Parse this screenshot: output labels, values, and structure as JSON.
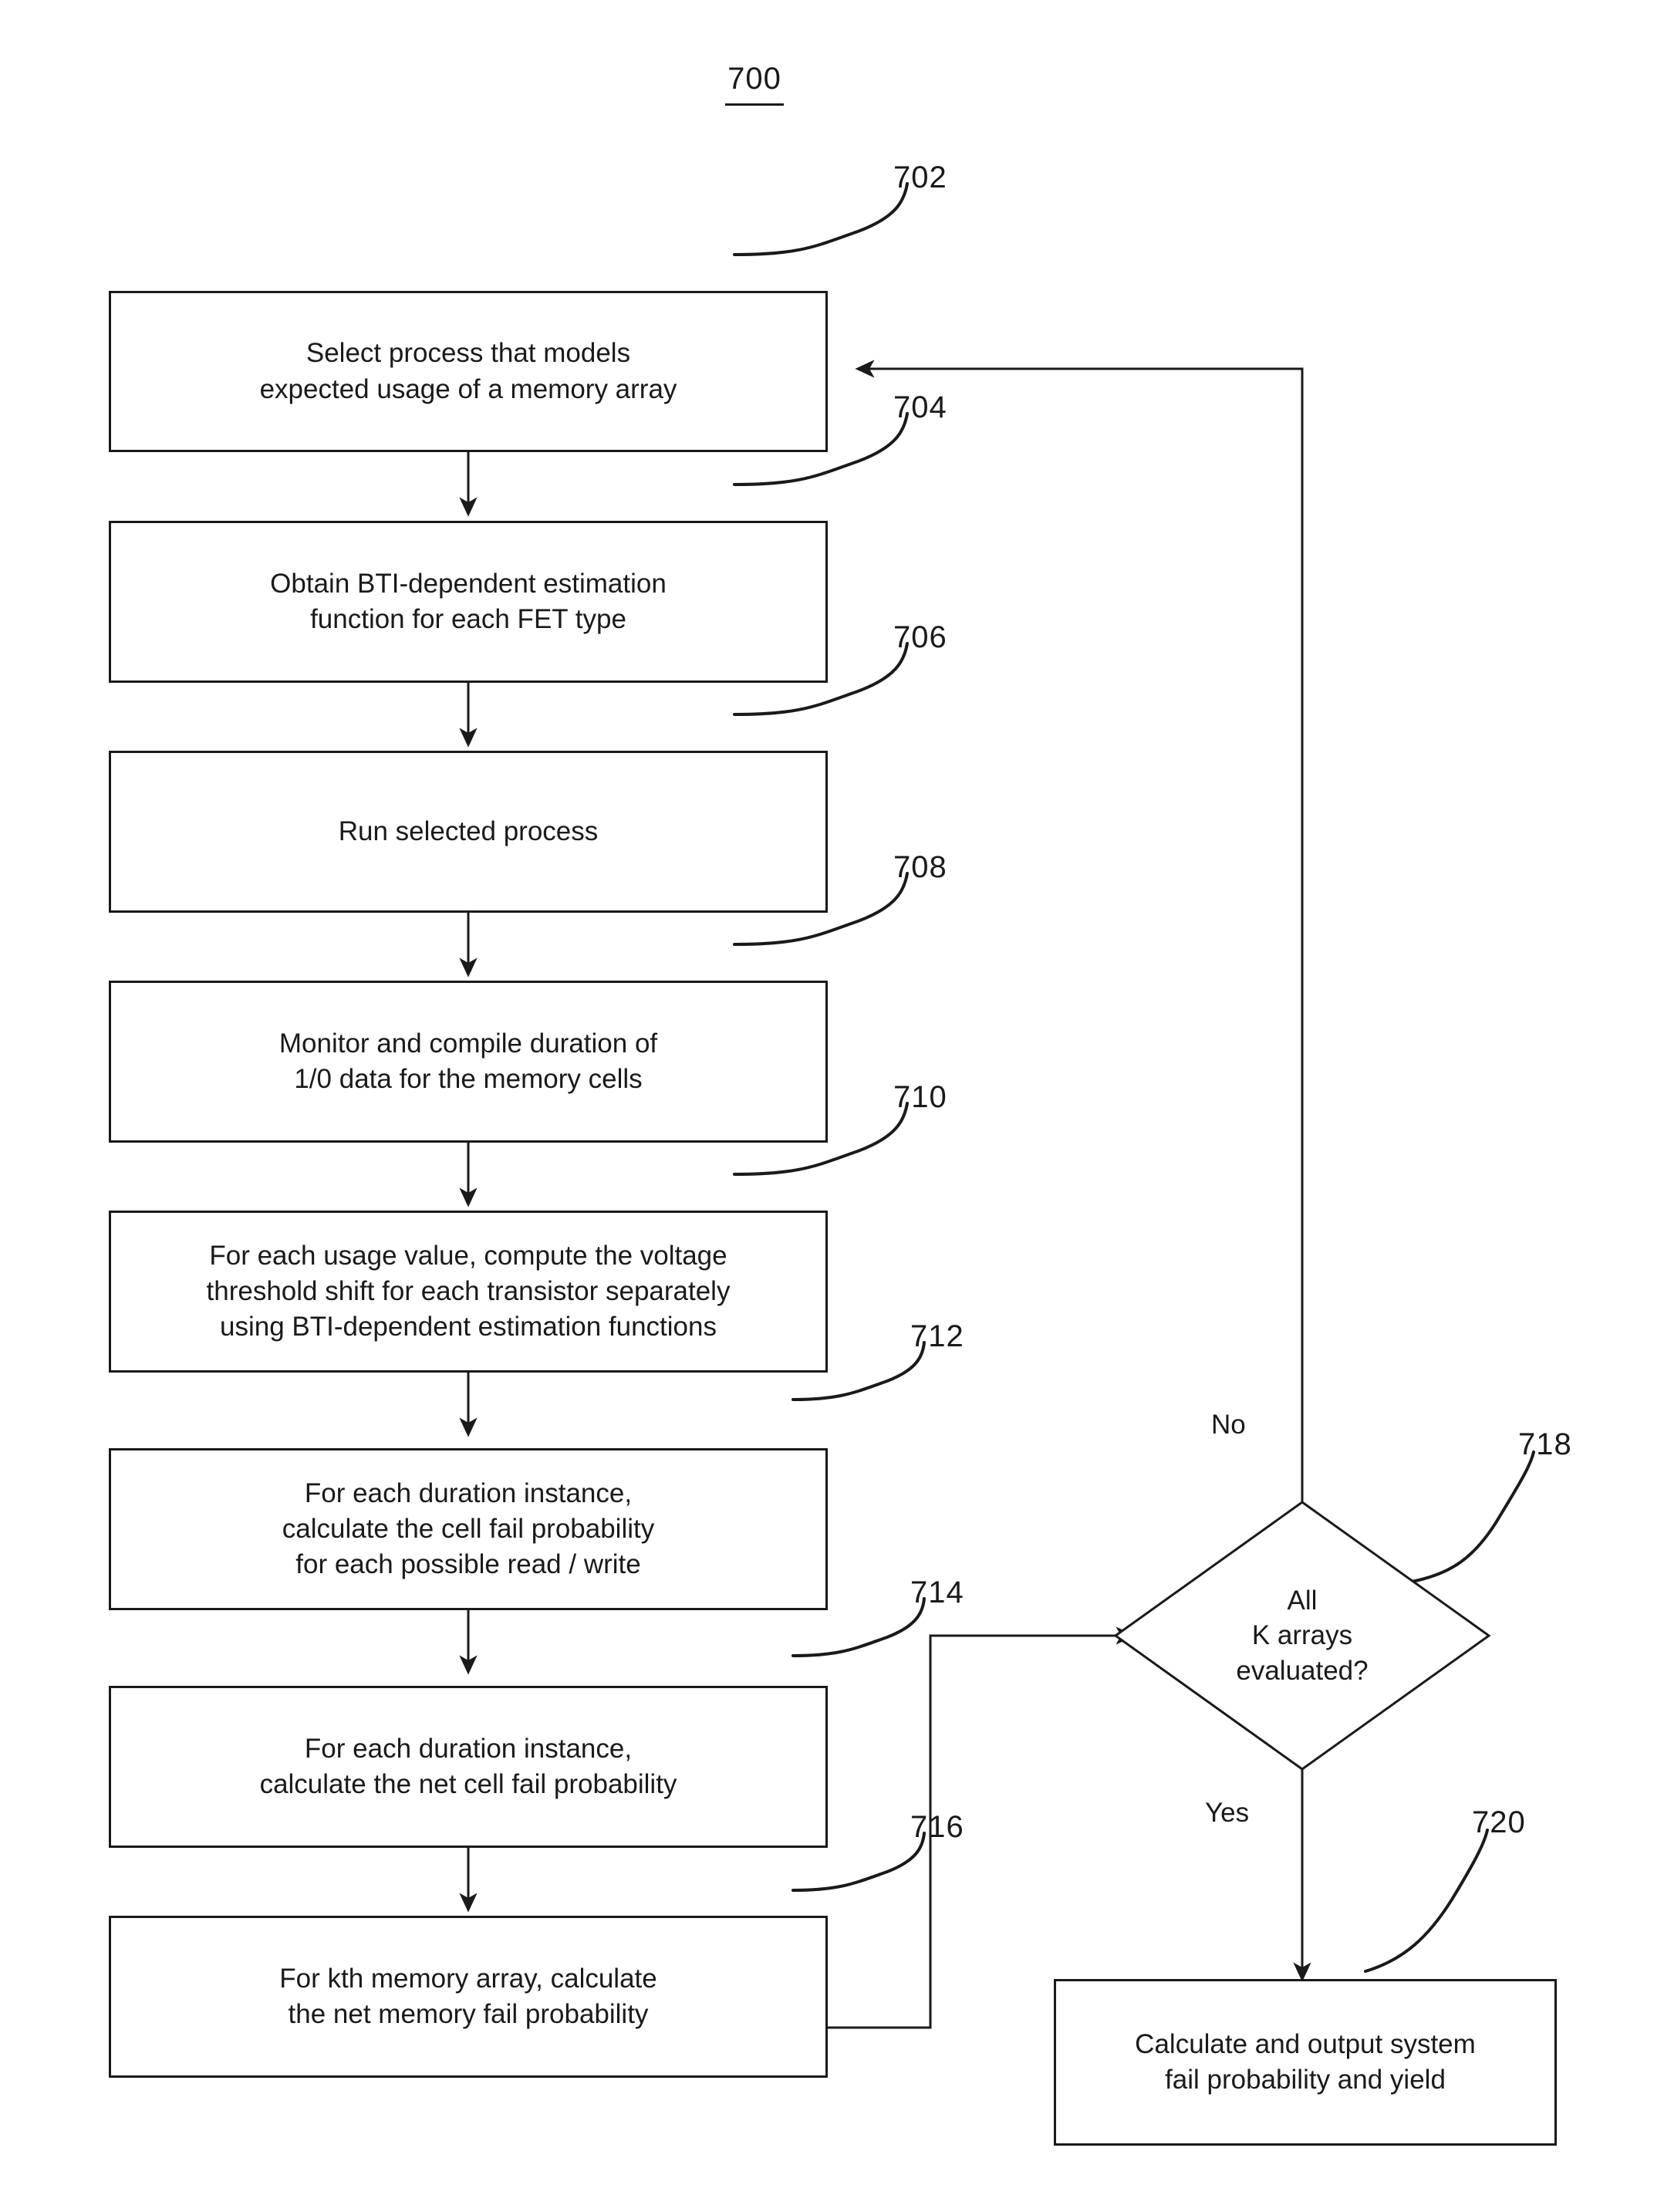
{
  "figure": {
    "number": "700",
    "type": "flowchart"
  },
  "nodes": [
    {
      "ref": "702",
      "shape": "process",
      "text": "Select process that models\nexpected usage of a memory array"
    },
    {
      "ref": "704",
      "shape": "process",
      "text": "Obtain BTI-dependent estimation\nfunction for each FET type"
    },
    {
      "ref": "706",
      "shape": "process",
      "text": "Run selected process"
    },
    {
      "ref": "708",
      "shape": "process",
      "text": "Monitor and compile duration of\n1/0 data for the memory cells"
    },
    {
      "ref": "710",
      "shape": "process",
      "text": "For each usage value, compute the voltage\nthreshold shift for each transistor separately\nusing BTI-dependent estimation functions"
    },
    {
      "ref": "712",
      "shape": "process",
      "text": "For each duration instance,\ncalculate the cell fail probability\nfor each possible read / write"
    },
    {
      "ref": "714",
      "shape": "process",
      "text": "For each duration instance,\ncalculate the net cell fail probability"
    },
    {
      "ref": "716",
      "shape": "process",
      "text": "For kth memory array, calculate\nthe net memory fail probability"
    },
    {
      "ref": "718",
      "shape": "decision",
      "text": "All\nK arrays\nevaluated?"
    },
    {
      "ref": "720",
      "shape": "process",
      "text": "Calculate and output system\nfail probability and yield"
    }
  ],
  "branch_labels": {
    "no": "No",
    "yes": "Yes"
  },
  "colors": {
    "stroke": "#1a1a1a",
    "fill": "#ffffff"
  }
}
